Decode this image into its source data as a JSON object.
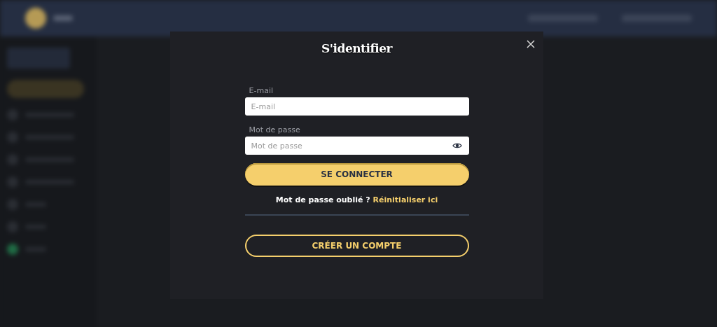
{
  "dialog": {
    "title": "S'identifier",
    "fields": [
      {
        "label": "E-mail",
        "placeholder": "E-mail",
        "kind": "text"
      },
      {
        "label": "Mot de passe",
        "placeholder": "Mot de passe",
        "kind": "password"
      }
    ],
    "login_button": "SE CONNECTER",
    "forgot": {
      "text": "Mot de passe oublié ?",
      "link": "Réinitialiser ici"
    },
    "create_button": "CRÉER UN COMPTE"
  }
}
